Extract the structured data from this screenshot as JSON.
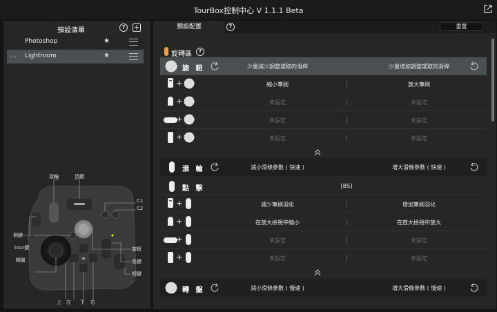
{
  "window": {
    "title": "TourBox控制中心 V 1.1.1 Beta"
  },
  "presets": {
    "title": "預設清單",
    "items": [
      {
        "name": "Photoshop",
        "selected": false
      },
      {
        "name": "Lightroom",
        "selected": true,
        "dots": "..."
      }
    ]
  },
  "device_labels": {
    "knob": "滾輪",
    "dial": "轉盤",
    "c1": "C1",
    "c2": "C2",
    "side": "側鍵",
    "tour": "tour鍵",
    "top": "頂鍵",
    "rotate": "旋鈕",
    "long": "長鍵",
    "short": "短鍵",
    "up": "上",
    "left": "左",
    "down": "下",
    "right": "右"
  },
  "tabs": {
    "preset_config": "預設配置",
    "reset": "重置"
  },
  "section": {
    "title": "旋轉區"
  },
  "rows": {
    "knob": {
      "name": "旋 鈕",
      "left": "少量減少調整選取的滑桿",
      "right": "少量增加調整選取的滑桿"
    },
    "knob_combos": [
      {
        "left": "縮小筆刷",
        "right": "放大筆刷",
        "active": true,
        "k1": "頂鍵"
      },
      {
        "left": "未設定",
        "right": "未設定",
        "active": false,
        "k1": "短鍵"
      },
      {
        "left": "未設定",
        "right": "未設定",
        "active": false,
        "k1": "側鍵"
      },
      {
        "left": "未設定",
        "right": "未設定",
        "active": false,
        "k1": "長鍵"
      }
    ],
    "scroll": {
      "name": "滾 輪",
      "left": "減小滑條參數 ( 快速 )",
      "right": "增大滑條參數 ( 快速 )"
    },
    "click": {
      "name": "點 擊",
      "value": "[BS]",
      "k1": "滾輪"
    },
    "scroll_combos": [
      {
        "left": "減少筆刷羽化",
        "right": "增加筆刷羽化",
        "active": true,
        "k1": "頂鍵"
      },
      {
        "left": "在放大檢視中縮小",
        "right": "在放大檢視中放大",
        "active": true,
        "k1": "短鍵"
      },
      {
        "left": "未設定",
        "right": "未設定",
        "active": false,
        "k1": "側鍵"
      },
      {
        "left": "未設定",
        "right": "未設定",
        "active": false,
        "k1": "長鍵"
      }
    ],
    "dial": {
      "name": "轉 盤",
      "left": "減小滑條參數 ( 慢速 )",
      "right": "增大滑條參數 ( 慢速 )"
    }
  },
  "colors": {
    "accent": "#f0a040",
    "selected_bg": "#4a4f52",
    "panel_bg": "#262626"
  }
}
